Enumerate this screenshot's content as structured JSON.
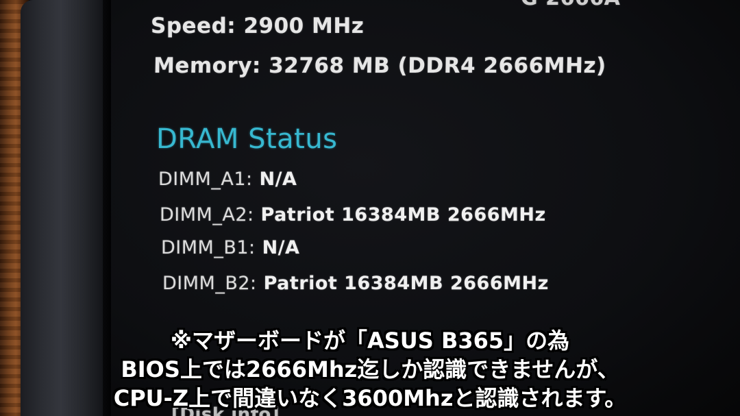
{
  "bios": {
    "title_fragment": "G 2666A",
    "speed": "Speed: 2900 MHz",
    "memory": "Memory: 32768 MB (DDR4 2666MHz)",
    "dram_heading": "DRAM Status",
    "dimm_slots": [
      {
        "slot": "DIMM_A1:",
        "value": "N/A"
      },
      {
        "slot": "DIMM_A2:",
        "value": "Patriot 16384MB 2666MHz"
      },
      {
        "slot": "DIMM_B1:",
        "value": "N/A"
      },
      {
        "slot": "DIMM_B2:",
        "value": "Patriot 16384MB 2666MHz"
      }
    ],
    "bottom_fragment": "[Disk info]"
  },
  "caption": {
    "line1": "※マザーボードが「ASUS B365」の為",
    "line2": "BIOS上では2666Mhz迄しか認識できませんが、",
    "line3": "CPU-Z上で間違いなく3600Mhzと認識されます。"
  }
}
